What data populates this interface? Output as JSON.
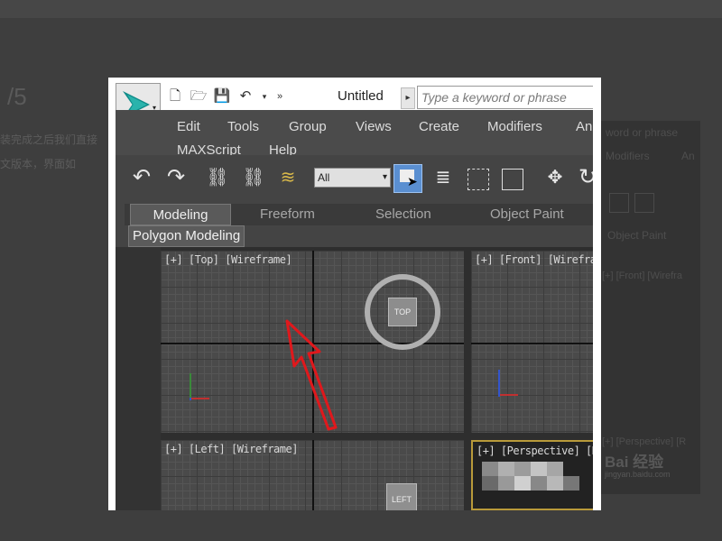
{
  "background": {
    "step": "/5",
    "text_line_1": "装完成之后我们直接",
    "text_line_2": "文版本，界面如",
    "ghost_search": "word or phrase",
    "ghost_menu": [
      "Modifiers",
      "An"
    ],
    "ghost_tab": "Object Paint",
    "ghost_viewport_front": "[+] [Front] [Wirefra",
    "ghost_viewport_persp": "[+] [Perspective] [R",
    "watermark": "Bai 经验",
    "watermark_sub": "jingyan.baidu.com"
  },
  "app": {
    "title": "Untitled",
    "search_placeholder": "Type a keyword or phrase",
    "quick_access_icons": [
      "new-file-icon",
      "open-folder-icon",
      "save-icon",
      "undo-icon",
      "dropdown-icon",
      "more-icon"
    ],
    "menu": {
      "row1": [
        "Edit",
        "Tools",
        "Group",
        "Views",
        "Create",
        "Modifiers",
        "An"
      ],
      "row2": [
        "MAXScript",
        "Help"
      ]
    },
    "toolbar": {
      "undo": "↶",
      "redo": "↷",
      "link": "⛓",
      "unlink": "⛓",
      "bind": "≋",
      "selection_filter": "All",
      "select_by_name": "≣",
      "move": "✥",
      "rotate": "↻"
    },
    "ribbon": {
      "tabs": [
        "Modeling",
        "Freeform",
        "Selection",
        "Object Paint"
      ],
      "active_tab": "Modeling",
      "sub_tab": "Polygon Modeling"
    },
    "viewports": {
      "top": "[+] [Top] [Wireframe]",
      "front": "[+] [Front] [Wirefra",
      "left": "[+] [Left] [Wireframe]",
      "perspective": "[+] [Perspective] [R",
      "viewcube_top": "TOP",
      "viewcube_left": "LEFT"
    },
    "annotation_color": "#e0181c",
    "accent_color": "#5a8fd1"
  }
}
